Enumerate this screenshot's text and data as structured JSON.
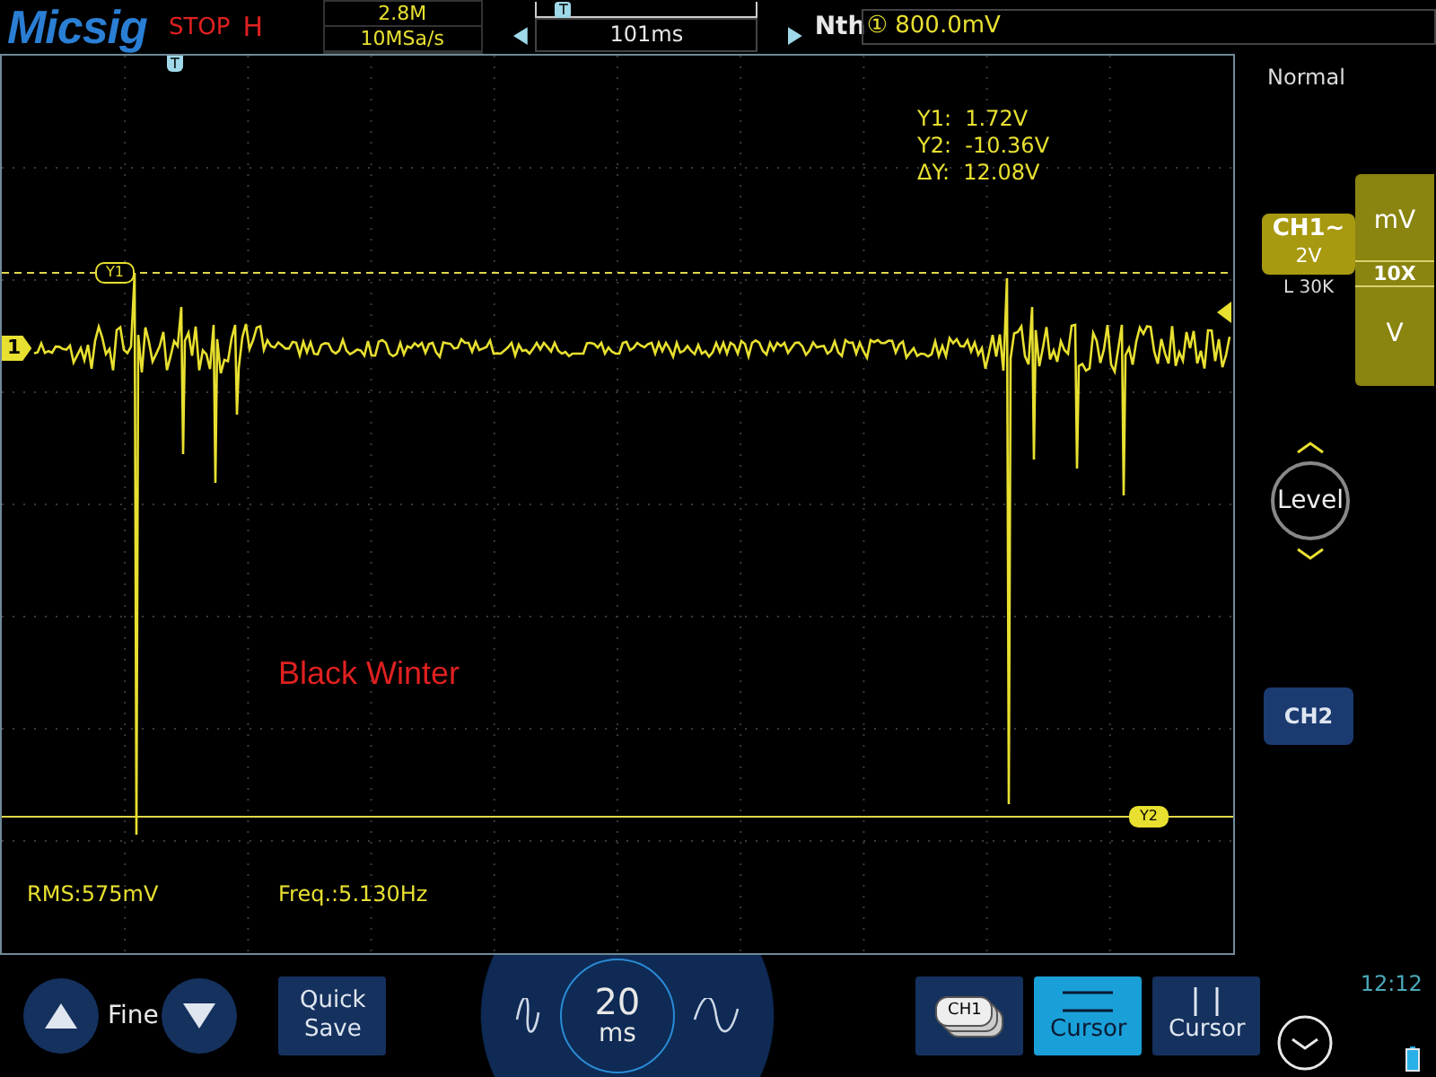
{
  "top_bar": {
    "logo": "Micsig",
    "run_state": "STOP",
    "mode_mark": "H",
    "memory_depth": "2.8M",
    "sample_rate": "10MSa/s",
    "timeline_marker": "T",
    "trigger_position": "101ms",
    "trigger_type": "Nth",
    "trigger_channel": "①",
    "trigger_level": "800.0mV"
  },
  "screen": {
    "trigger_marker": "T",
    "channel_marker": "1",
    "cursor_labels": [
      "Y1",
      "Y2"
    ],
    "cursor_readout": [
      "Y1:  1.72V",
      "Y2:  -10.36V",
      "ΔY:  12.08V"
    ],
    "annotation": "Black Winter",
    "measurements": [
      "RMS:575mV",
      "Freq.:5.130Hz"
    ]
  },
  "right_panel": {
    "trigger_mode": "Normal",
    "ch1": {
      "label": "CH1",
      "coupling": "~",
      "scale": "2V",
      "info": "L 30K"
    },
    "probe": {
      "upper": "mV",
      "ratio": "10X",
      "lower": "V"
    },
    "level_knob": "Level",
    "ch2": "CH2"
  },
  "bottom_bar": {
    "fine_label": "Fine",
    "quick_save": "Quick Save",
    "timebase_value": "20",
    "timebase_unit": "ms",
    "channel_button": "CH1",
    "cursor_buttons": [
      {
        "kind": "horizontal",
        "label": "Cursor",
        "selected": true
      },
      {
        "kind": "vertical",
        "label": "Cursor",
        "selected": false
      }
    ],
    "clock": "12:12"
  }
}
